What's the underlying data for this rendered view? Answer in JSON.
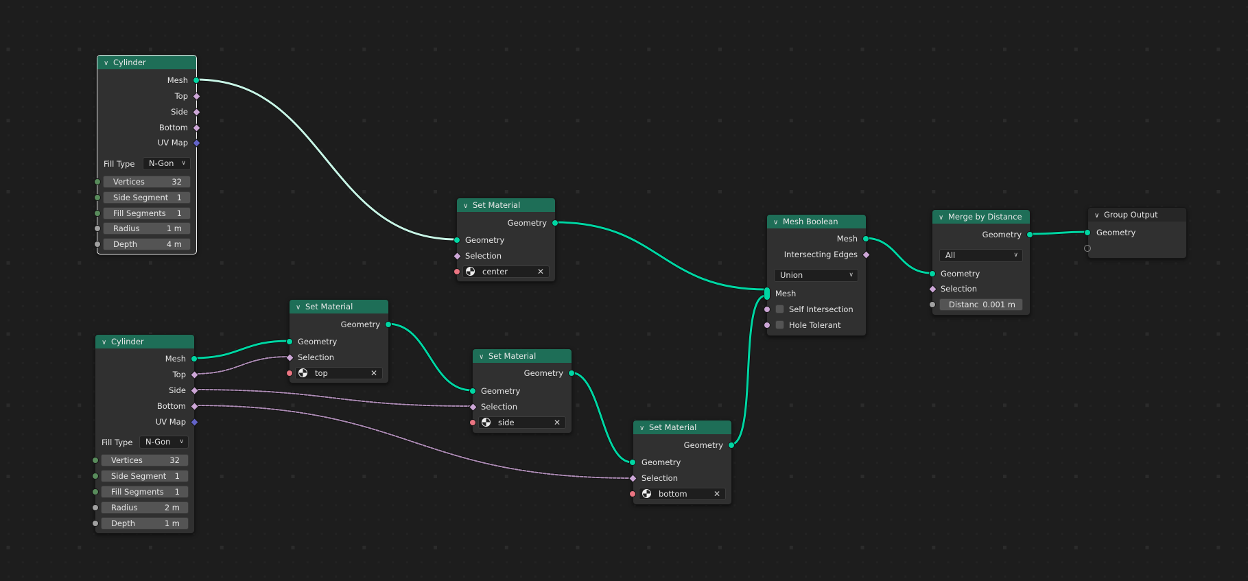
{
  "editor": "Geometry Node Editor",
  "colors": {
    "background": "#1d1d1d",
    "node_body": "#303030",
    "header_geometry": "#1e6e57",
    "socket_geometry": "#00d6a3",
    "socket_boolean_field": "#cca6d6",
    "socket_vector": "#6363c7",
    "socket_integer": "#598c5c",
    "socket_float": "#a1a1a1",
    "socket_material": "#eb7582",
    "link_geometry": "#00d6a3",
    "link_selected": "#c8f5e6",
    "link_field": "#cca6d6"
  },
  "nodes": {
    "cylinder_1": {
      "title": "Cylinder",
      "selected": true,
      "outputs": [
        "Mesh",
        "Top",
        "Side",
        "Bottom",
        "UV Map"
      ],
      "fill_type_label": "Fill Type",
      "fill_type_value": "N-Gon",
      "fields": [
        {
          "label": "Vertices",
          "value": "32"
        },
        {
          "label": "Side Segment",
          "value": "1"
        },
        {
          "label": "Fill Segments",
          "value": "1"
        },
        {
          "label": "Radius",
          "value": "1 m"
        },
        {
          "label": "Depth",
          "value": "4 m"
        }
      ]
    },
    "cylinder_2": {
      "title": "Cylinder",
      "selected": false,
      "outputs": [
        "Mesh",
        "Top",
        "Side",
        "Bottom",
        "UV Map"
      ],
      "fill_type_label": "Fill Type",
      "fill_type_value": "N-Gon",
      "fields": [
        {
          "label": "Vertices",
          "value": "32"
        },
        {
          "label": "Side Segment",
          "value": "1"
        },
        {
          "label": "Fill Segments",
          "value": "1"
        },
        {
          "label": "Radius",
          "value": "2 m"
        },
        {
          "label": "Depth",
          "value": "1 m"
        }
      ]
    },
    "set_material_center": {
      "title": "Set Material",
      "output": "Geometry",
      "inputs": [
        "Geometry",
        "Selection"
      ],
      "material": "center"
    },
    "set_material_top": {
      "title": "Set Material",
      "output": "Geometry",
      "inputs": [
        "Geometry",
        "Selection"
      ],
      "material": "top"
    },
    "set_material_side": {
      "title": "Set Material",
      "output": "Geometry",
      "inputs": [
        "Geometry",
        "Selection"
      ],
      "material": "side"
    },
    "set_material_bottom": {
      "title": "Set Material",
      "output": "Geometry",
      "inputs": [
        "Geometry",
        "Selection"
      ],
      "material": "bottom"
    },
    "mesh_boolean": {
      "title": "Mesh Boolean",
      "outputs": [
        "Mesh",
        "Intersecting Edges"
      ],
      "operation": "Union",
      "inputs": [
        "Mesh"
      ],
      "checkboxes": [
        {
          "label": "Self Intersection",
          "checked": false
        },
        {
          "label": "Hole Tolerant",
          "checked": false
        }
      ]
    },
    "merge_by_distance": {
      "title": "Merge by Distance",
      "output": "Geometry",
      "mode": "All",
      "inputs": [
        "Geometry",
        "Selection"
      ],
      "distance_label": "Distanc",
      "distance_value": "0.001 m"
    },
    "group_output": {
      "title": "Group Output",
      "inputs": [
        "Geometry"
      ]
    }
  },
  "links": [
    {
      "from": "cylinder_1.Mesh",
      "to": "set_material_center.Geometry",
      "type": "geometry",
      "selected": true
    },
    {
      "from": "set_material_center.Geometry",
      "to": "mesh_boolean.Mesh",
      "type": "geometry"
    },
    {
      "from": "cylinder_2.Mesh",
      "to": "set_material_top.Geometry",
      "type": "geometry"
    },
    {
      "from": "cylinder_2.Top",
      "to": "set_material_top.Selection",
      "type": "field"
    },
    {
      "from": "set_material_top.Geometry",
      "to": "set_material_side.Geometry",
      "type": "geometry"
    },
    {
      "from": "cylinder_2.Side",
      "to": "set_material_side.Selection",
      "type": "field"
    },
    {
      "from": "set_material_side.Geometry",
      "to": "set_material_bottom.Geometry",
      "type": "geometry"
    },
    {
      "from": "cylinder_2.Bottom",
      "to": "set_material_bottom.Selection",
      "type": "field"
    },
    {
      "from": "set_material_bottom.Geometry",
      "to": "mesh_boolean.Mesh",
      "type": "geometry"
    },
    {
      "from": "mesh_boolean.Mesh",
      "to": "merge_by_distance.Geometry",
      "type": "geometry"
    },
    {
      "from": "merge_by_distance.Geometry",
      "to": "group_output.Geometry",
      "type": "geometry"
    }
  ]
}
